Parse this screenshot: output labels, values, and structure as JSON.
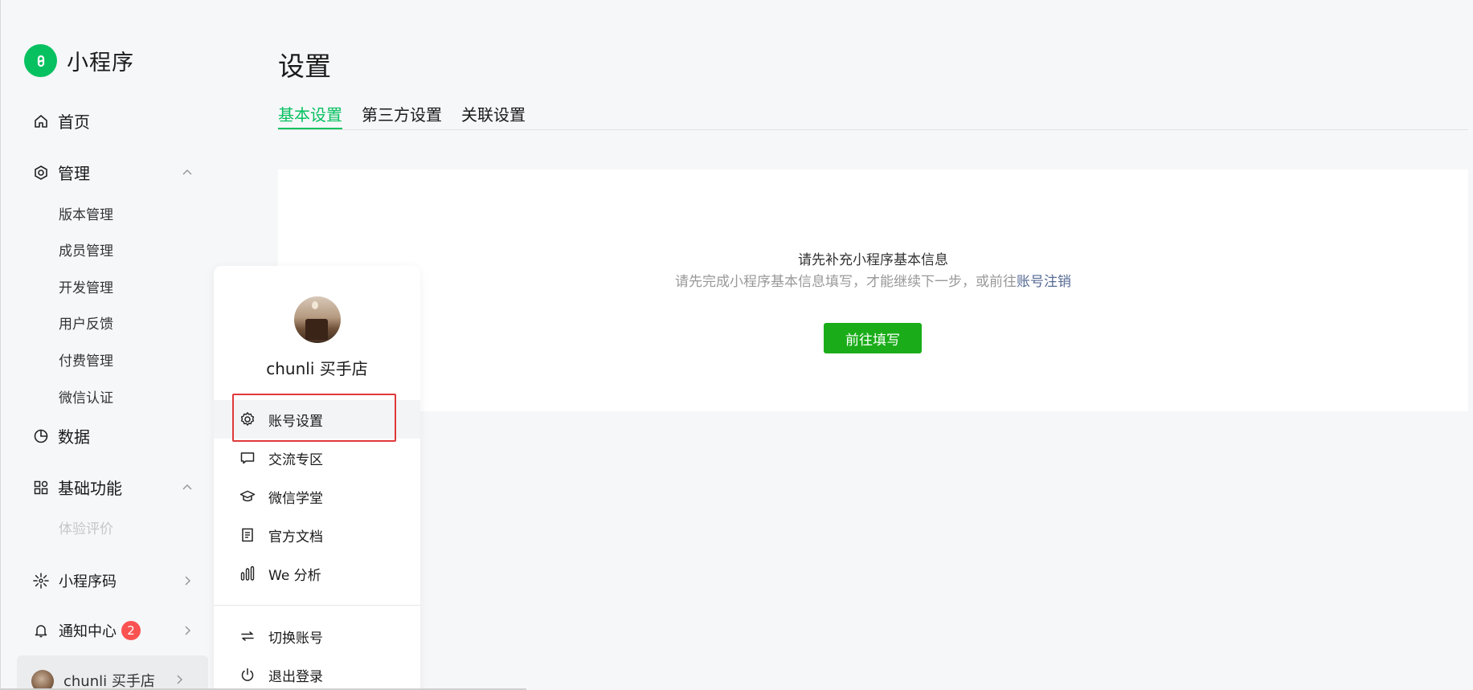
{
  "app": {
    "logo_text": "小程序",
    "accent": "#07c160"
  },
  "sidebar": {
    "home": "首页",
    "manage": {
      "label": "管理",
      "children": [
        "版本管理",
        "成员管理",
        "开发管理",
        "用户反馈",
        "付费管理",
        "微信认证"
      ]
    },
    "data": "数据",
    "basic": {
      "label": "基础功能",
      "children": [
        "体验评价"
      ]
    },
    "qrcode": "小程序码",
    "notify": {
      "label": "通知中心",
      "badge": "2"
    },
    "user": "chunli 买手店"
  },
  "main": {
    "title": "设置",
    "tabs": [
      {
        "label": "基本设置",
        "active": true
      },
      {
        "label": "第三方设置",
        "active": false
      },
      {
        "label": "关联设置",
        "active": false
      }
    ],
    "notice": {
      "title": "请先补充小程序基本信息",
      "desc": "请先完成小程序基本信息填写，才能继续下一步，或前往",
      "link": "账号注销",
      "button": "前往填写"
    }
  },
  "popup": {
    "name": "chunli 买手店",
    "items": [
      "账号设置",
      "交流专区",
      "微信学堂",
      "官方文档",
      "We 分析"
    ],
    "bottom_items": [
      "切换账号",
      "退出登录"
    ],
    "highlight_color": "#e03a3a"
  }
}
